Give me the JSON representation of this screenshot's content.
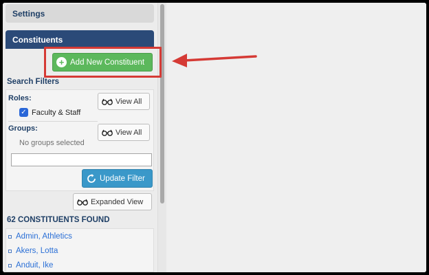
{
  "sidebar": {
    "settings_label": "Settings",
    "constituents_label": "Constituents",
    "add_button_label": "Add New Constituent",
    "search_filters_title": "Search Filters",
    "roles": {
      "label": "Roles:",
      "view_all_label": "View All",
      "checked_role": "Faculty & Staff"
    },
    "groups": {
      "label": "Groups:",
      "view_all_label": "View All",
      "empty_text": "No groups selected"
    },
    "filter_input_value": "",
    "update_filter_label": "Update Filter",
    "expanded_view_label": "Expanded View",
    "results_count_text": "62 CONSTITUENTS FOUND",
    "results": [
      "Admin, Athletics",
      "Akers, Lotta",
      "Anduit, Ike"
    ]
  },
  "colors": {
    "accent_red": "#d53a35",
    "add_green": "#5cb85c",
    "update_blue": "#3a98c9",
    "header_navy": "#2b4a78"
  },
  "icons": {
    "add": "plus-circle-icon",
    "view": "glasses-icon",
    "update": "refresh-icon"
  }
}
